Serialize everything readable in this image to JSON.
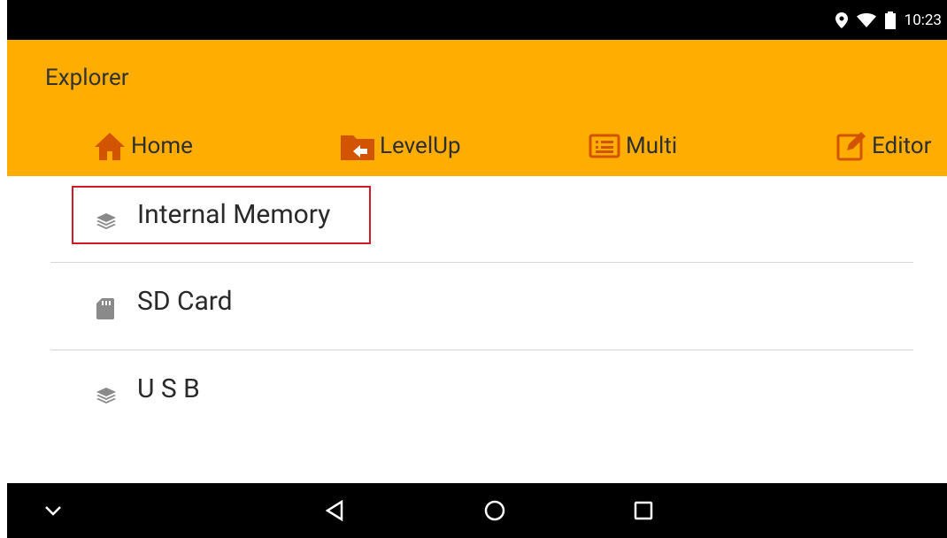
{
  "status_bar": {
    "time": "10:23",
    "icons": [
      "location-icon",
      "wifi-icon",
      "battery-icon"
    ]
  },
  "app_bar": {
    "title": "Explorer",
    "color": "#ffad00",
    "toolbar": [
      {
        "label": "Home",
        "icon": "home-icon"
      },
      {
        "label": "LevelUp",
        "icon": "folder-up-icon"
      },
      {
        "label": "Multi",
        "icon": "list-icon"
      },
      {
        "label": "Editor",
        "icon": "edit-icon"
      }
    ]
  },
  "storage_list": [
    {
      "label": "Internal Memory",
      "icon": "layers-icon",
      "selected": true
    },
    {
      "label": "SD Card",
      "icon": "sd-card-icon"
    },
    {
      "label": "U S B",
      "icon": "layers-icon"
    }
  ],
  "nav_bar": {
    "buttons": [
      "chevron-down-icon",
      "back-icon",
      "home-circle-icon",
      "recents-icon"
    ]
  }
}
